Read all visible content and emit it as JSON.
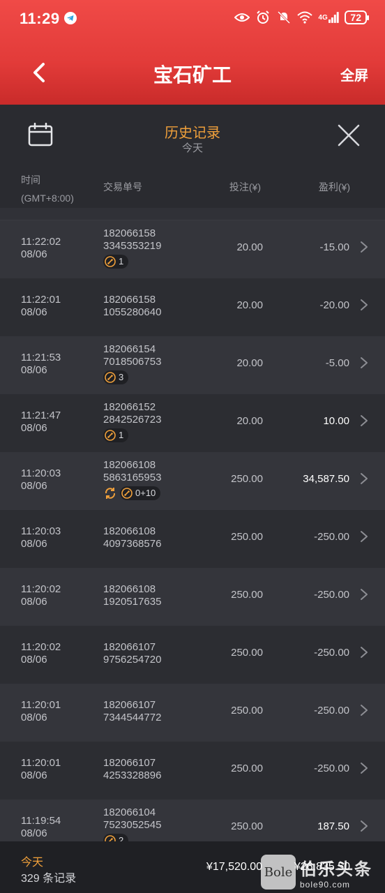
{
  "status_bar": {
    "time": "11:29",
    "network": "4G",
    "battery": "72"
  },
  "nav": {
    "title": "宝石矿工",
    "fullscreen_label": "全屏"
  },
  "history": {
    "title": "历史记录",
    "subtitle": "今天"
  },
  "columns": {
    "time_line1": "时间",
    "time_line2": "(GMT+8:00)",
    "order": "交易单号",
    "bet": "投注(¥)",
    "profit": "盈利(¥)"
  },
  "rows": [
    {
      "time": "11:22:02",
      "date": "08/06",
      "order1": "182066158",
      "order2": "3345353219",
      "badge": "1",
      "bet": "20.00",
      "profit": "-15.00",
      "positive": false
    },
    {
      "time": "11:22:01",
      "date": "08/06",
      "order1": "182066158",
      "order2": "1055280640",
      "badge": "",
      "bet": "20.00",
      "profit": "-20.00",
      "positive": false
    },
    {
      "time": "11:21:53",
      "date": "08/06",
      "order1": "182066154",
      "order2": "7018506753",
      "badge": "3",
      "bet": "20.00",
      "profit": "-5.00",
      "positive": false
    },
    {
      "time": "11:21:47",
      "date": "08/06",
      "order1": "182066152",
      "order2": "2842526723",
      "badge": "1",
      "bet": "20.00",
      "profit": "10.00",
      "positive": true
    },
    {
      "time": "11:20:03",
      "date": "08/06",
      "order1": "182066108",
      "order2": "5863165953",
      "badge": "0+10",
      "spin": true,
      "bet": "250.00",
      "profit": "34,587.50",
      "positive": true
    },
    {
      "time": "11:20:03",
      "date": "08/06",
      "order1": "182066108",
      "order2": "4097368576",
      "badge": "",
      "bet": "250.00",
      "profit": "-250.00",
      "positive": false
    },
    {
      "time": "11:20:02",
      "date": "08/06",
      "order1": "182066108",
      "order2": "1920517635",
      "badge": "",
      "bet": "250.00",
      "profit": "-250.00",
      "positive": false
    },
    {
      "time": "11:20:02",
      "date": "08/06",
      "order1": "182066107",
      "order2": "9756254720",
      "badge": "",
      "bet": "250.00",
      "profit": "-250.00",
      "positive": false
    },
    {
      "time": "11:20:01",
      "date": "08/06",
      "order1": "182066107",
      "order2": "7344544772",
      "badge": "",
      "bet": "250.00",
      "profit": "-250.00",
      "positive": false
    },
    {
      "time": "11:20:01",
      "date": "08/06",
      "order1": "182066107",
      "order2": "4253328896",
      "badge": "",
      "bet": "250.00",
      "profit": "-250.00",
      "positive": false
    },
    {
      "time": "11:19:54",
      "date": "08/06",
      "order1": "182066104",
      "order2": "7523052545",
      "badge": "2",
      "bet": "250.00",
      "profit": "187.50",
      "positive": true
    }
  ],
  "footer": {
    "today": "今天",
    "count": "329 条记录",
    "total_bet": "¥17,520.00",
    "total_profit": "¥26,835.50"
  },
  "watermark": {
    "logo": "Bole",
    "name": "伯乐头条",
    "url": "bole90.com"
  },
  "colors": {
    "header_red": "#e23b39",
    "accent_orange": "#f0a03b",
    "background": "#2a2b30"
  }
}
